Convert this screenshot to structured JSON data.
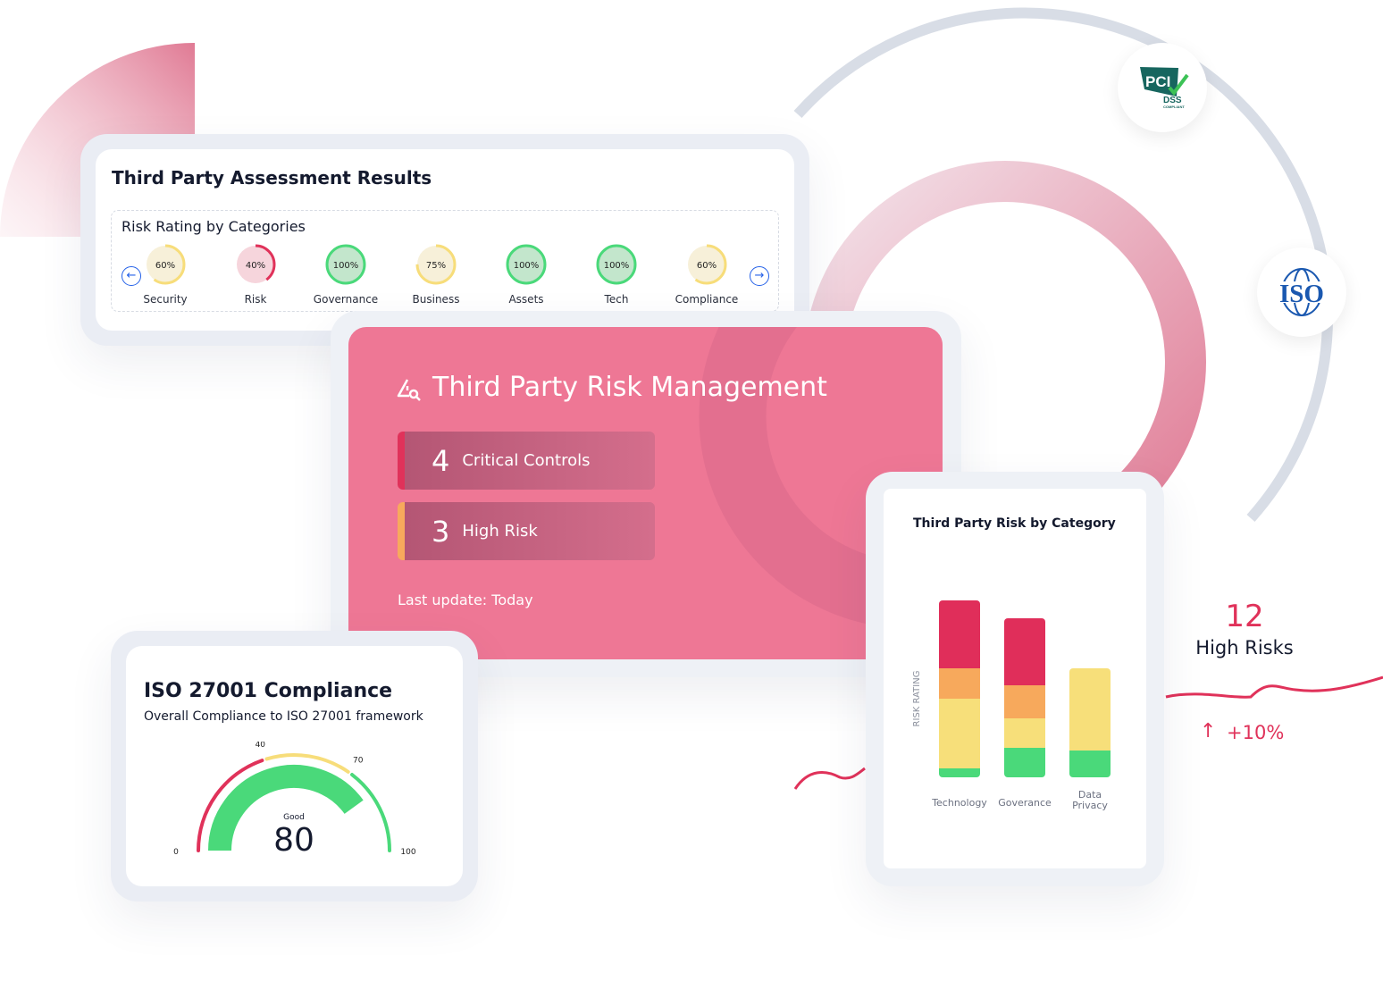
{
  "assessment": {
    "title": "Third Party Assessment Results",
    "subtitle": "Risk Rating by Categories",
    "categories": [
      {
        "label": "Security",
        "value": "60%",
        "percent": 60,
        "status": "medium"
      },
      {
        "label": "Risk",
        "value": "40%",
        "percent": 40,
        "status": "high"
      },
      {
        "label": "Governance",
        "value": "100%",
        "percent": 100,
        "status": "good"
      },
      {
        "label": "Business",
        "value": "75%",
        "percent": 75,
        "status": "medium"
      },
      {
        "label": "Assets",
        "value": "100%",
        "percent": 100,
        "status": "good"
      },
      {
        "label": "Tech",
        "value": "100%",
        "percent": 100,
        "status": "good"
      },
      {
        "label": "Compliance",
        "value": "60%",
        "percent": 60,
        "status": "medium"
      }
    ],
    "prev_icon": "arrow-left-icon",
    "next_icon": "arrow-right-icon"
  },
  "tprm": {
    "title": "Third Party Risk Management",
    "icon": "alert-search-icon",
    "stats": [
      {
        "number": "4",
        "label": "Critical Controls",
        "accent": "#e0325a"
      },
      {
        "number": "3",
        "label": "High Risk",
        "accent": "#f7a95c"
      }
    ],
    "last_update": "Last update: Today"
  },
  "iso_card": {
    "title": "ISO 27001 Compliance",
    "subtitle": "Overall Compliance to ISO 27001 framework",
    "gauge": {
      "value": 80,
      "value_label": "80",
      "rating": "Good",
      "min": 0,
      "max": 100,
      "ticks": [
        "0",
        "40",
        "70",
        "100"
      ],
      "bands": [
        {
          "from": 0,
          "to": 40,
          "color": "#e0325a"
        },
        {
          "from": 40,
          "to": 70,
          "color": "#f7dd7a"
        },
        {
          "from": 70,
          "to": 100,
          "color": "#4ad97a"
        }
      ],
      "fill_color": "#4ad97a"
    }
  },
  "chart_data": {
    "type": "bar",
    "stacked": true,
    "title": "Third Party Risk by Category",
    "ylabel": "RISK RATING",
    "xlabel": "",
    "categories": [
      "Technology",
      "Goverance",
      "Data Privacy"
    ],
    "series": [
      {
        "color": "#4ad97a",
        "values": [
          1.0,
          3.3,
          3.0
        ]
      },
      {
        "color": "#f7df7a",
        "values": [
          7.8,
          3.3,
          9.2
        ]
      },
      {
        "color": "#f7a95c",
        "values": [
          3.4,
          3.7,
          0
        ]
      },
      {
        "color": "#e02e5a",
        "values": [
          7.6,
          7.5,
          0
        ]
      }
    ],
    "grid": false
  },
  "highlight": {
    "count": "12",
    "label": "High Risks",
    "change": "+10%",
    "change_icon": "arrow-up-icon"
  },
  "badges": {
    "pci": "PCI DSS COMPLIANT",
    "iso": "ISO"
  },
  "colors": {
    "accent_pink": "#ee7795",
    "red": "#e0325a",
    "green": "#4ad97a",
    "yellow": "#f7dd7a"
  }
}
